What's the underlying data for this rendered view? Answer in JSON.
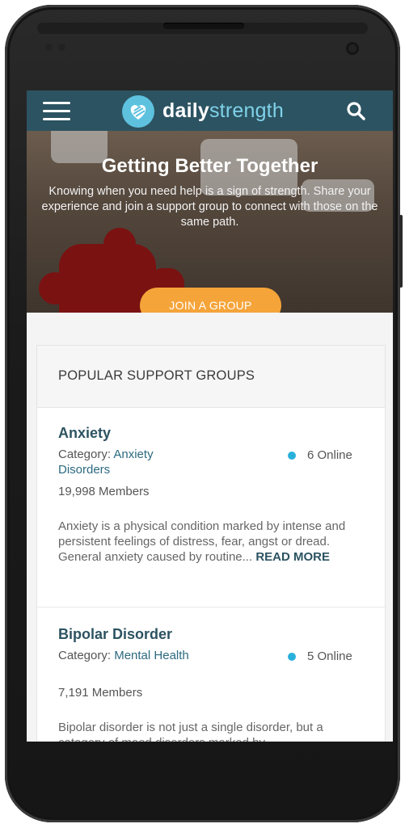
{
  "app": {
    "logo_bold": "daily",
    "logo_light": "strength"
  },
  "hero": {
    "title": "Getting Better Together",
    "text": "Knowing when you need help is a sign of strength. Share your experience and join a support group to connect with those on the same path.",
    "cta_label": "JOIN A GROUP"
  },
  "popular": {
    "heading": "POPULAR SUPPORT GROUPS",
    "groups": [
      {
        "title": "Anxiety",
        "category_prefix": "Category: ",
        "category": "Anxiety Disorders",
        "online": "6 Online",
        "members": "19,998 Members",
        "description": "Anxiety is a physical condition marked by intense and persistent feelings of distress, fear, angst or dread. General anxiety caused by routine...",
        "read_more": "READ MORE"
      },
      {
        "title": "Bipolar Disorder",
        "category_prefix": "Category: ",
        "category": "Mental Health",
        "online": "5 Online",
        "members": "7,191 Members",
        "description": "Bipolar disorder is not just a single disorder, but a category of mood disorders marked by"
      }
    ]
  },
  "colors": {
    "header": "#2c5361",
    "logo_accent": "#5ec2df",
    "cta": "#f5a43a",
    "online_dot": "#2ab0dc"
  },
  "icons": [
    "menu-icon",
    "logo-heart-icon",
    "search-icon"
  ]
}
